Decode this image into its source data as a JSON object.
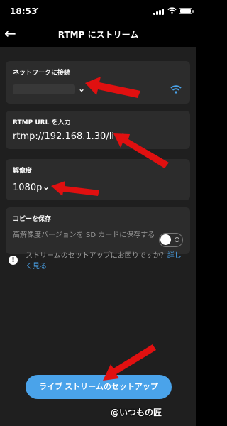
{
  "status_bar": {
    "time": "18:53",
    "location_arrow": "➚"
  },
  "nav": {
    "back_icon": "←",
    "title": "RTMP にストリーム"
  },
  "network": {
    "label": "ネットワークに接続",
    "chevron": "⌄"
  },
  "rtmp_url": {
    "label": "RTMP URL を入力",
    "value": "rtmp://192.168.1.30/live"
  },
  "resolution": {
    "label": "解像度",
    "value": "1080p",
    "chevron": "⌄"
  },
  "save_copy": {
    "label": "コピーを保存",
    "description": "高解像度バージョンを SD カードに保存する",
    "toggle_on": false
  },
  "help": {
    "icon": "!",
    "text": "ストリームのセットアップにお困りですか？",
    "link": "詳しく見る"
  },
  "cta": {
    "label": "ライブ ストリームのセットアップ"
  },
  "watermark": "@いつもの匠",
  "colors": {
    "accent": "#4aa3ea",
    "arrow": "#e01010",
    "card": "#2c2c2c",
    "background": "#1f1f1f"
  }
}
